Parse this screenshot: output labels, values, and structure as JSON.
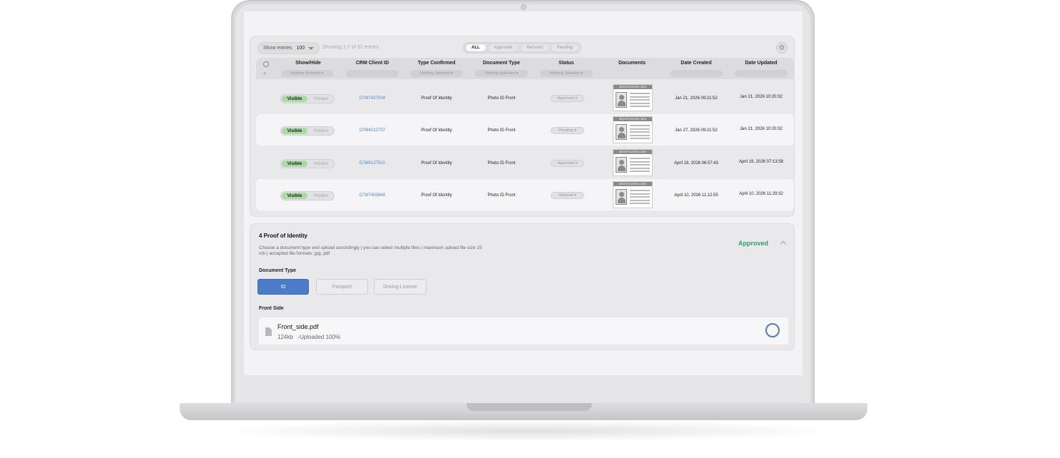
{
  "table": {
    "show_entries_label": "Show entries",
    "show_entries_value": "100",
    "showing_text": "Showing 1-7 of 32 entries",
    "filters": [
      "ALL",
      "Approved",
      "Refused",
      "Pending"
    ],
    "columns": [
      "Show/Hide",
      "CRM Client ID",
      "Type Confirmed",
      "Document Type",
      "Status",
      "Documents",
      "Date Created",
      "Date Updated"
    ],
    "column_filter_placeholder": "Nothing Selected",
    "visible_label": "Visible",
    "hidden_label": "Hidden",
    "card_header": "IDENTIFICATION CARD",
    "rows": [
      {
        "client_id": "D7M7427034",
        "type_confirmed": "Proof Of Identity",
        "doc_type": "Photo ID Front",
        "status": "Approved",
        "created": "Jan 21, 2026 09:21:52",
        "updated": "Jan 21, 2026 10:20:32"
      },
      {
        "client_id": "D7M4212707",
        "type_confirmed": "Proof Of Identity",
        "doc_type": "Photo ID Front",
        "status": "Pending",
        "created": "Jan 27, 2026 09:21:52",
        "updated": "Jan 21, 2026 10:20:32"
      },
      {
        "client_id": "D7M5127502",
        "type_confirmed": "Proof Of Identity",
        "doc_type": "Photo ID Front",
        "status": "Approved",
        "created": "April 19, 2026 06:57:43",
        "updated": "April 19, 2026 07:13:58"
      },
      {
        "client_id": "D7M7403849",
        "type_confirmed": "Proof Of Identity",
        "doc_type": "Photo ID Front",
        "status": "Refused",
        "created": "April 10, 2026 11:12:55",
        "updated": "April 10, 2026 11:29:32"
      }
    ]
  },
  "doc_section": {
    "title": "4 Proof of Identity",
    "description": "Choose a document type and upload accordingly | you can select multiple files | maximum upload file size 15 mb |      accepted file formats: jpg, pdf",
    "status": "Approved",
    "doc_type_label": "Document Type",
    "doc_types": [
      "ID",
      "Passport",
      "Driving License"
    ],
    "front_label": "Front Side",
    "file_name": "Front_side.pdf",
    "file_size": "124kb",
    "file_status": "-Uploaded 100%"
  },
  "colors": {
    "accent": "#4a7cc9",
    "approved": "#2f9a6d",
    "visible_toggle": "#a9dca0",
    "link": "#4c84c9"
  }
}
